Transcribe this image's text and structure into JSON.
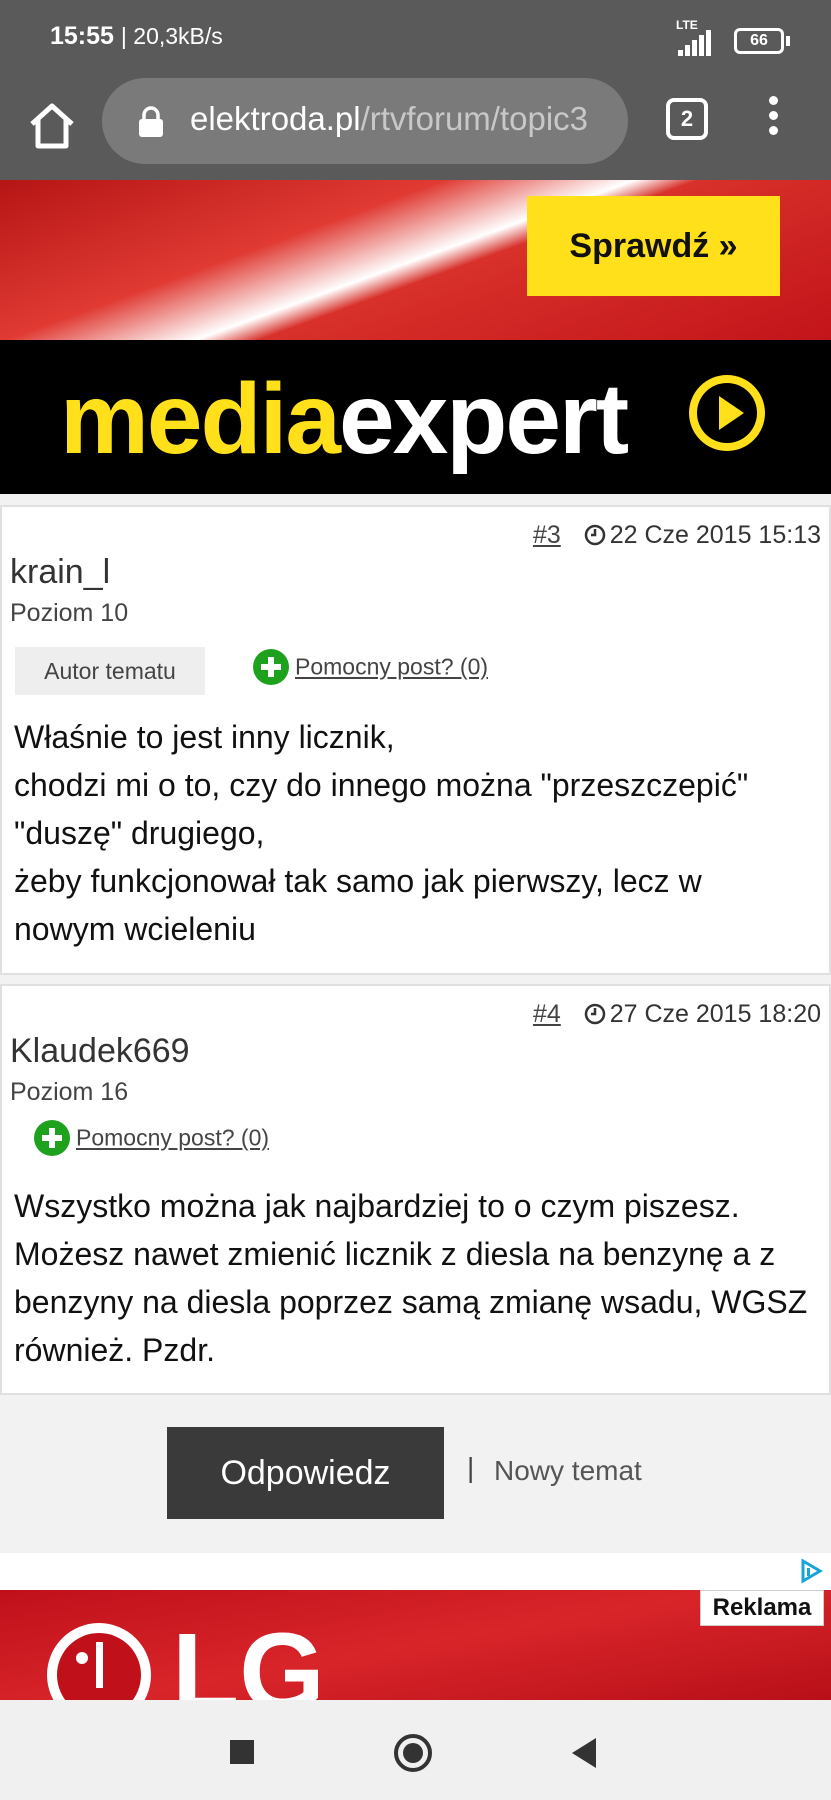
{
  "status_bar": {
    "time": "15:55",
    "speed": "| 20,3kB/s",
    "network": "LTE",
    "battery": "66"
  },
  "browser": {
    "url_domain": "elektroda.pl",
    "url_path": "/rtvforum/topic3",
    "tab_count": "2"
  },
  "ad_top": {
    "cta": "Sprawdź »",
    "brand_part1": "media",
    "brand_part2": "expert",
    "colors": {
      "yellow": "#ffe01a",
      "red": "#c2141a",
      "black": "#000000"
    }
  },
  "posts": [
    {
      "number": "#3",
      "date": "22 Cze 2015 15:13",
      "author": "krain_l",
      "level": "Poziom 10",
      "badge": "Autor tematu",
      "helpful": "Pomocny post? (0)",
      "body": [
        "Właśnie to jest inny licznik,",
        "chodzi mi o to, czy do innego można \"przeszczepić\"",
        "\"duszę\" drugiego,",
        "żeby funkcjonował tak samo jak pierwszy, lecz w",
        "nowym wcieleniu"
      ]
    },
    {
      "number": "#4",
      "date": "27 Cze 2015 18:20",
      "author": "Klaudek669",
      "level": "Poziom 16",
      "helpful": "Pomocny post? (0)",
      "body": [
        "Wszystko można jak najbardziej to o czym piszesz.",
        "Możesz nawet zmienić licznik z diesla na benzynę a z",
        "benzyny na diesla poprzez samą zmianę wsadu, WGSZ",
        "również. Pzdr."
      ]
    }
  ],
  "actions": {
    "reply": "Odpowiedz",
    "separator": "|",
    "new_topic": "Nowy temat"
  },
  "ad_bottom": {
    "label": "Reklama",
    "brand": "LG"
  },
  "colors": {
    "helpful_green": "#1ea21e",
    "reply_button": "#3a3a3a"
  }
}
